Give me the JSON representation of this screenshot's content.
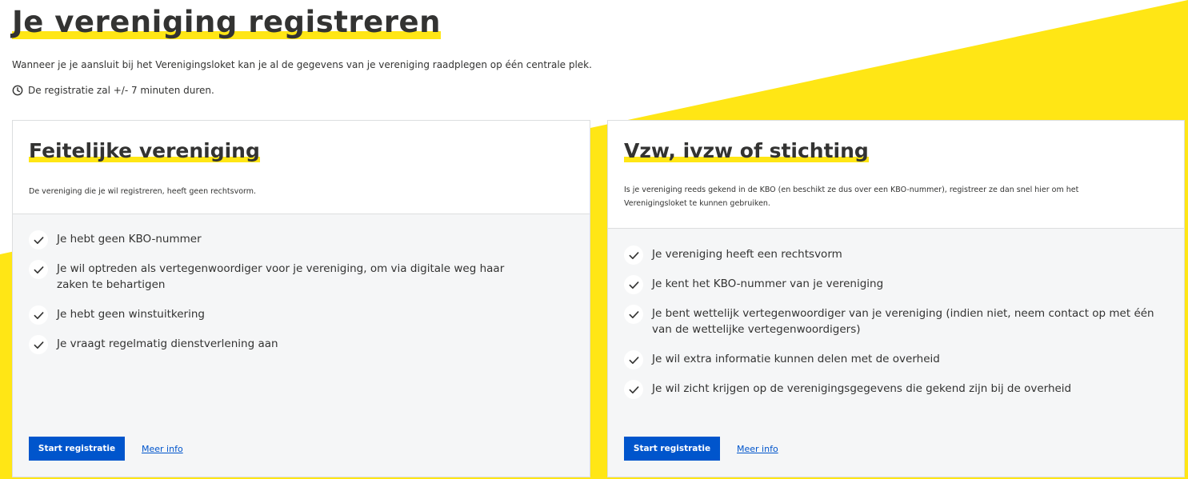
{
  "page": {
    "title": "Je vereniging registreren",
    "intro": "Wanneer je je aansluit bij het Verenigingsloket kan je al de gegevens van je vereniging raadplegen op één centrale plek.",
    "duration": "De registratie zal +/- 7 minuten duren.",
    "duration_icon": "clock-icon"
  },
  "colors": {
    "accent_yellow": "#ffe615",
    "primary_blue": "#0055cc",
    "text_dark": "#333332",
    "card_body": "#f5f6f7"
  },
  "cards": [
    {
      "title": "Feitelijke vereniging",
      "description": "De vereniging die je wil registreren, heeft geen rechtsvorm.",
      "checks": [
        "Je hebt geen KBO-nummer",
        "Je wil optreden als vertegenwoordiger voor je vereniging, om via digitale weg haar zaken te behartigen",
        "Je hebt geen winstuitkering",
        "Je vraagt regelmatig dienstverlening aan"
      ],
      "primary_label": "Start registratie",
      "link_label": "Meer info"
    },
    {
      "title": "Vzw, ivzw of stichting",
      "description": "Is je vereniging reeds gekend in de KBO (en beschikt ze dus over een KBO-nummer), registreer ze dan snel hier om het Verenigingsloket te kunnen gebruiken.",
      "checks": [
        "Je vereniging heeft een rechtsvorm",
        "Je kent het KBO-nummer van je vereniging",
        "Je bent wettelijk vertegenwoordiger van je vereniging (indien niet, neem contact op met één van de wettelijke vertegenwoordigers)",
        "Je wil extra informatie kunnen delen met de overheid",
        "Je wil zicht krijgen op de verenigingsgegevens die gekend zijn bij de overheid"
      ],
      "primary_label": "Start registratie",
      "link_label": "Meer info"
    }
  ]
}
